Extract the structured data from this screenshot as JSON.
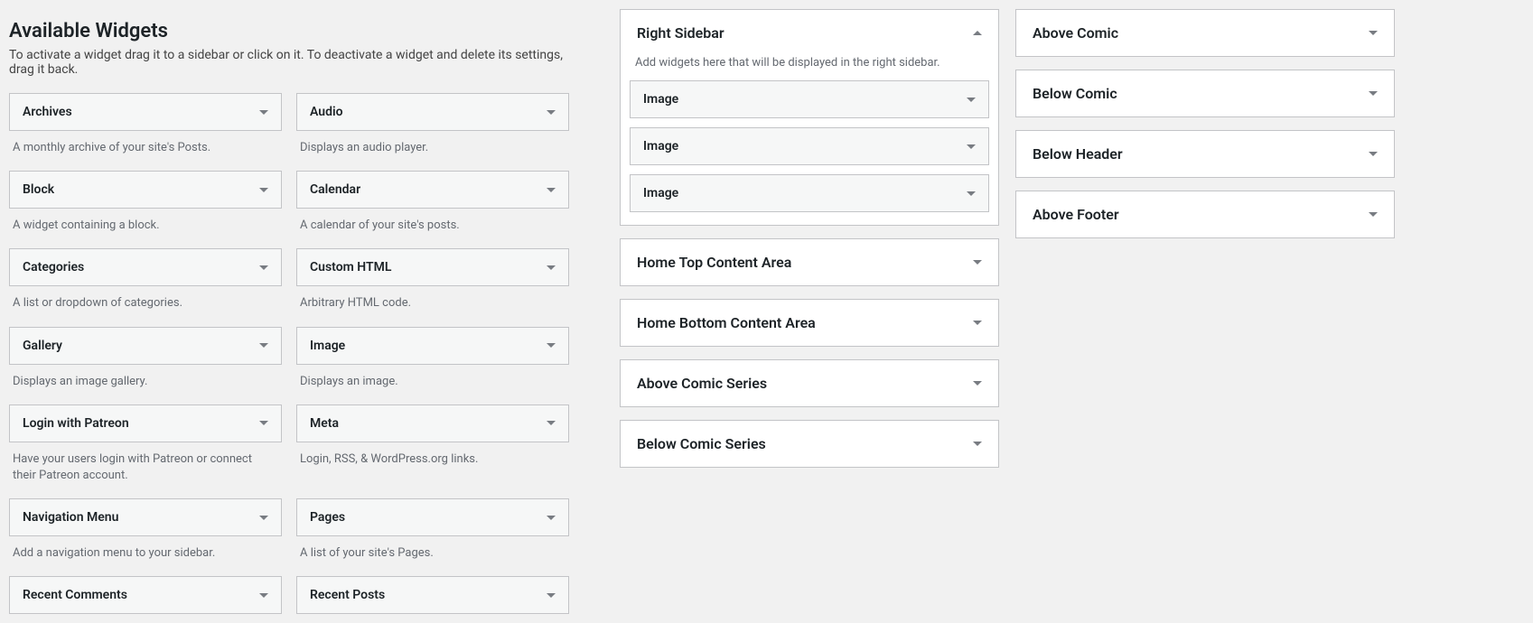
{
  "available": {
    "title": "Available Widgets",
    "description": "To activate a widget drag it to a sidebar or click on it. To deactivate a widget and delete its settings, drag it back.",
    "widgets": [
      {
        "name": "Archives",
        "desc": "A monthly archive of your site's Posts."
      },
      {
        "name": "Audio",
        "desc": "Displays an audio player."
      },
      {
        "name": "Block",
        "desc": "A widget containing a block."
      },
      {
        "name": "Calendar",
        "desc": "A calendar of your site's posts."
      },
      {
        "name": "Categories",
        "desc": "A list or dropdown of categories."
      },
      {
        "name": "Custom HTML",
        "desc": "Arbitrary HTML code."
      },
      {
        "name": "Gallery",
        "desc": "Displays an image gallery."
      },
      {
        "name": "Image",
        "desc": "Displays an image."
      },
      {
        "name": "Login with Patreon",
        "desc": "Have your users login with Patreon or connect their Patreon account."
      },
      {
        "name": "Meta",
        "desc": "Login, RSS, & WordPress.org links."
      },
      {
        "name": "Navigation Menu",
        "desc": "Add a navigation menu to your sidebar."
      },
      {
        "name": "Pages",
        "desc": "A list of your site's Pages."
      },
      {
        "name": "Recent Comments",
        "desc": ""
      },
      {
        "name": "Recent Posts",
        "desc": ""
      }
    ]
  },
  "sidebars_col1": [
    {
      "title": "Right Sidebar",
      "expanded": true,
      "hint": "Add widgets here that will be displayed in the right sidebar.",
      "items": [
        {
          "title": "Image"
        },
        {
          "title": "Image"
        },
        {
          "title": "Image"
        }
      ]
    },
    {
      "title": "Home Top Content Area",
      "expanded": false
    },
    {
      "title": "Home Bottom Content Area",
      "expanded": false
    },
    {
      "title": "Above Comic Series",
      "expanded": false
    },
    {
      "title": "Below Comic Series",
      "expanded": false
    }
  ],
  "sidebars_col2": [
    {
      "title": "Above Comic",
      "expanded": false
    },
    {
      "title": "Below Comic",
      "expanded": false
    },
    {
      "title": "Below Header",
      "expanded": false
    },
    {
      "title": "Above Footer",
      "expanded": false
    }
  ]
}
